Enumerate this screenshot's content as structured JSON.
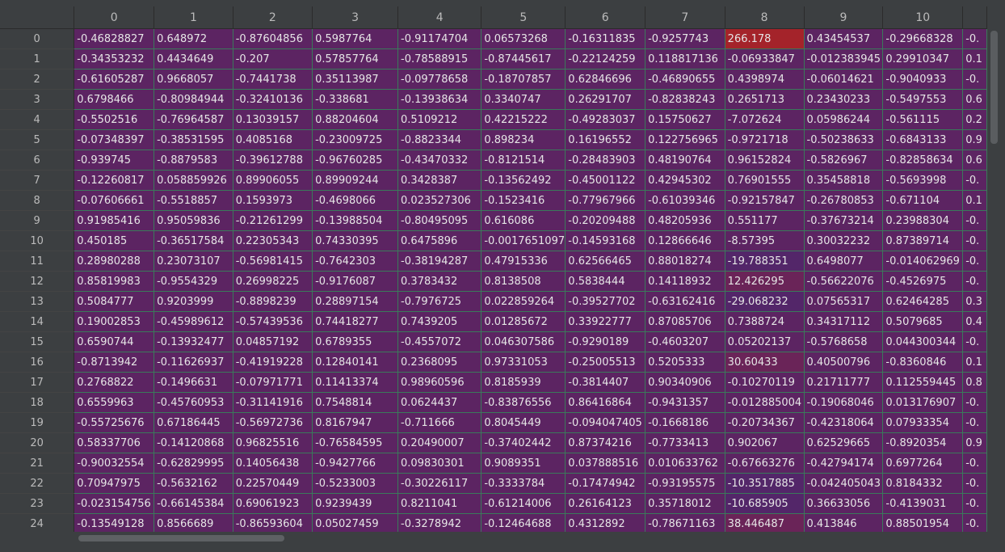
{
  "grid": {
    "columns": [
      "0",
      "1",
      "2",
      "3",
      "4",
      "5",
      "6",
      "7",
      "8",
      "9",
      "10",
      ""
    ],
    "rows": [
      {
        "index": "0",
        "values": [
          "-0.46828827",
          "0.648972",
          "-0.87604856",
          "0.5987764",
          "-0.91174704",
          "0.06573268",
          "-0.16311835",
          "-0.9257743",
          "266.178",
          "0.43454537",
          "-0.29668328",
          "-0."
        ]
      },
      {
        "index": "1",
        "values": [
          "-0.34353232",
          "0.4434649",
          "-0.207",
          "0.57857764",
          "-0.78588915",
          "-0.87445617",
          "-0.22124259",
          "0.118817136",
          "-0.06933847",
          "-0.012383945",
          "0.29910347",
          "0.1"
        ]
      },
      {
        "index": "2",
        "values": [
          "-0.61605287",
          "0.9668057",
          "-0.7441738",
          "0.35113987",
          "-0.09778658",
          "-0.18707857",
          "0.62846696",
          "-0.46890655",
          "0.4398974",
          "-0.06014621",
          "-0.9040933",
          "-0."
        ]
      },
      {
        "index": "3",
        "values": [
          "0.6798466",
          "-0.80984944",
          "-0.32410136",
          "-0.338681",
          "-0.13938634",
          "0.3340747",
          "0.26291707",
          "-0.82838243",
          "0.2651713",
          "0.23430233",
          "-0.5497553",
          "0.6"
        ]
      },
      {
        "index": "4",
        "values": [
          "-0.5502516",
          "-0.76964587",
          "0.13039157",
          "0.88204604",
          "0.5109212",
          "0.42215222",
          "-0.49283037",
          "0.15750627",
          "-7.072624",
          "0.05986244",
          "-0.561115",
          "0.2"
        ]
      },
      {
        "index": "5",
        "values": [
          "-0.07348397",
          "-0.38531595",
          "0.4085168",
          "-0.23009725",
          "-0.8823344",
          "0.898234",
          "0.16196552",
          "0.122756965",
          "-0.9721718",
          "-0.50238633",
          "-0.6843133",
          "0.9"
        ]
      },
      {
        "index": "6",
        "values": [
          "-0.939745",
          "-0.8879583",
          "-0.39612788",
          "-0.96760285",
          "-0.43470332",
          "-0.8121514",
          "-0.28483903",
          "0.48190764",
          "0.96152824",
          "-0.5826967",
          "-0.82858634",
          "0.6"
        ]
      },
      {
        "index": "7",
        "values": [
          "-0.12260817",
          "0.058859926",
          "0.89906055",
          "0.89909244",
          "0.3428387",
          "-0.13562492",
          "-0.45001122",
          "0.42945302",
          "0.76901555",
          "0.35458818",
          "-0.5693998",
          "-0."
        ]
      },
      {
        "index": "8",
        "values": [
          "-0.07606661",
          "-0.5518857",
          "0.1593973",
          "-0.4698066",
          "0.023527306",
          "-0.1523416",
          "-0.77967966",
          "-0.61039346",
          "-0.92157847",
          "-0.26780853",
          "-0.671104",
          "0.1"
        ]
      },
      {
        "index": "9",
        "values": [
          "0.91985416",
          "0.95059836",
          "-0.21261299",
          "-0.13988504",
          "-0.80495095",
          "0.616086",
          "-0.20209488",
          "0.48205936",
          "0.551177",
          "-0.37673214",
          "0.23988304",
          "-0."
        ]
      },
      {
        "index": "10",
        "values": [
          "0.450185",
          "-0.36517584",
          "0.22305343",
          "0.74330395",
          "0.6475896",
          "-0.0017651097",
          "-0.14593168",
          "0.12866646",
          "-8.57395",
          "0.30032232",
          "0.87389714",
          "-0."
        ]
      },
      {
        "index": "11",
        "values": [
          "0.28980288",
          "0.23073107",
          "-0.56981415",
          "-0.7642303",
          "-0.38194287",
          "0.47915336",
          "0.62566465",
          "0.88018274",
          "-19.788351",
          "0.6498077",
          "-0.014062969",
          "-0."
        ]
      },
      {
        "index": "12",
        "values": [
          "0.85819983",
          "-0.9554329",
          "0.26998225",
          "-0.9176087",
          "0.3783432",
          "0.8138508",
          "0.5838444",
          "0.14118932",
          "12.426295",
          "-0.56622076",
          "-0.4526975",
          "-0."
        ]
      },
      {
        "index": "13",
        "values": [
          "0.5084777",
          "0.9203999",
          "-0.8898239",
          "0.28897154",
          "-0.7976725",
          "0.022859264",
          "-0.39527702",
          "-0.63162416",
          "-29.068232",
          "0.07565317",
          "0.62464285",
          "0.3"
        ]
      },
      {
        "index": "14",
        "values": [
          "0.19002853",
          "-0.45989612",
          "-0.57439536",
          "0.74418277",
          "0.7439205",
          "0.01285672",
          "0.33922777",
          "0.87085706",
          "0.7388724",
          "0.34317112",
          "0.5079685",
          "0.4"
        ]
      },
      {
        "index": "15",
        "values": [
          "0.6590744",
          "-0.13932477",
          "0.04857192",
          "0.6789355",
          "-0.4557072",
          "0.046307586",
          "-0.9290189",
          "-0.4603207",
          "0.05202137",
          "-0.5768658",
          "0.044300344",
          "-0."
        ]
      },
      {
        "index": "16",
        "values": [
          "-0.8713942",
          "-0.11626937",
          "-0.41919228",
          "0.12840141",
          "0.2368095",
          "0.97331053",
          "-0.25005513",
          "0.5205333",
          "30.60433",
          "0.40500796",
          "-0.8360846",
          "0.1"
        ]
      },
      {
        "index": "17",
        "values": [
          "0.2768822",
          "-0.1496631",
          "-0.07971771",
          "0.11413374",
          "0.98960596",
          "0.8185939",
          "-0.3814407",
          "0.90340906",
          "-0.10270119",
          "0.21711777",
          "0.112559445",
          "0.8"
        ]
      },
      {
        "index": "18",
        "values": [
          "0.6559963",
          "-0.45760953",
          "-0.31141916",
          "0.7548814",
          "0.0624437",
          "-0.83876556",
          "0.86416864",
          "-0.9431357",
          "-0.012885004",
          "-0.19068046",
          "0.013176907",
          "-0."
        ]
      },
      {
        "index": "19",
        "values": [
          "-0.55725676",
          "0.67186445",
          "-0.56972736",
          "0.8167947",
          "-0.711666",
          "0.8045449",
          "-0.094047405",
          "-0.1668186",
          "-0.20734367",
          "-0.42318064",
          "0.07933354",
          "-0."
        ]
      },
      {
        "index": "20",
        "values": [
          "0.58337706",
          "-0.14120868",
          "0.96825516",
          "-0.76584595",
          "0.20490007",
          "-0.37402442",
          "0.87374216",
          "-0.7733413",
          "0.902067",
          "0.62529665",
          "-0.8920354",
          "0.9"
        ]
      },
      {
        "index": "21",
        "values": [
          "-0.90032554",
          "-0.62829995",
          "0.14056438",
          "-0.9427766",
          "0.09830301",
          "0.9089351",
          "0.037888516",
          "0.010633762",
          "-0.67663276",
          "-0.42794174",
          "0.6977264",
          "-0."
        ]
      },
      {
        "index": "22",
        "values": [
          "0.70947975",
          "-0.5632162",
          "0.22570449",
          "-0.5233003",
          "-0.30226117",
          "-0.3333784",
          "-0.17474942",
          "-0.93195575",
          "-10.3517885",
          "-0.042405043",
          "0.8184332",
          "-0."
        ]
      },
      {
        "index": "23",
        "values": [
          "-0.023154756",
          "-0.66145384",
          "0.69061923",
          "0.9239439",
          "0.8211041",
          "-0.61214006",
          "0.26164123",
          "0.35718012",
          "-10.685905",
          "0.36633056",
          "-0.4139031",
          "-0."
        ]
      },
      {
        "index": "24",
        "values": [
          "-0.13549128",
          "0.8566689",
          "-0.86593604",
          "0.05027459",
          "-0.3278942",
          "-0.12464688",
          "0.4312892",
          "-0.78671163",
          "38.446487",
          "0.413846",
          "0.88501954",
          "-0."
        ]
      }
    ]
  },
  "colors": {
    "cell_default": "#5c2462",
    "cell_max_highlight": "#a4232a",
    "cell_warm": "#6a2458",
    "cell_cool": "#532669",
    "grid_line": "#3a7a5a",
    "header_bg": "#3c3f41"
  }
}
